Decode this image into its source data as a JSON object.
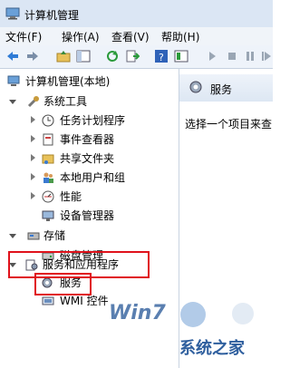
{
  "window": {
    "title": "计算机管理"
  },
  "menu": [
    "文件(F)",
    "操作(A)",
    "查看(V)",
    "帮助(H)"
  ],
  "toolbar": [
    "back-icon",
    "forward-icon",
    "up-folder-icon",
    "show-hide-tree-icon",
    "refresh-icon",
    "export-icon",
    "help-icon",
    "properties-icon",
    "play-icon",
    "stop-icon",
    "pause-icon",
    "restart-icon"
  ],
  "tree": {
    "root": "计算机管理(本地)",
    "system_tools": "系统工具",
    "task_scheduler": "任务计划程序",
    "event_viewer": "事件查看器",
    "shared_folders": "共享文件夹",
    "local_users": "本地用户和组",
    "performance": "性能",
    "device_manager": "设备管理器",
    "storage": "存储",
    "disk_management": "磁盘管理",
    "services_apps": "服务和应用程序",
    "services": "服务",
    "wmi": "WMI 控件"
  },
  "right_pane": {
    "title": "服务",
    "description": "选择一个项目来查"
  },
  "highlight_color": "#e0121b",
  "watermark": {
    "brand": "Win7",
    "site": "系统之家"
  }
}
